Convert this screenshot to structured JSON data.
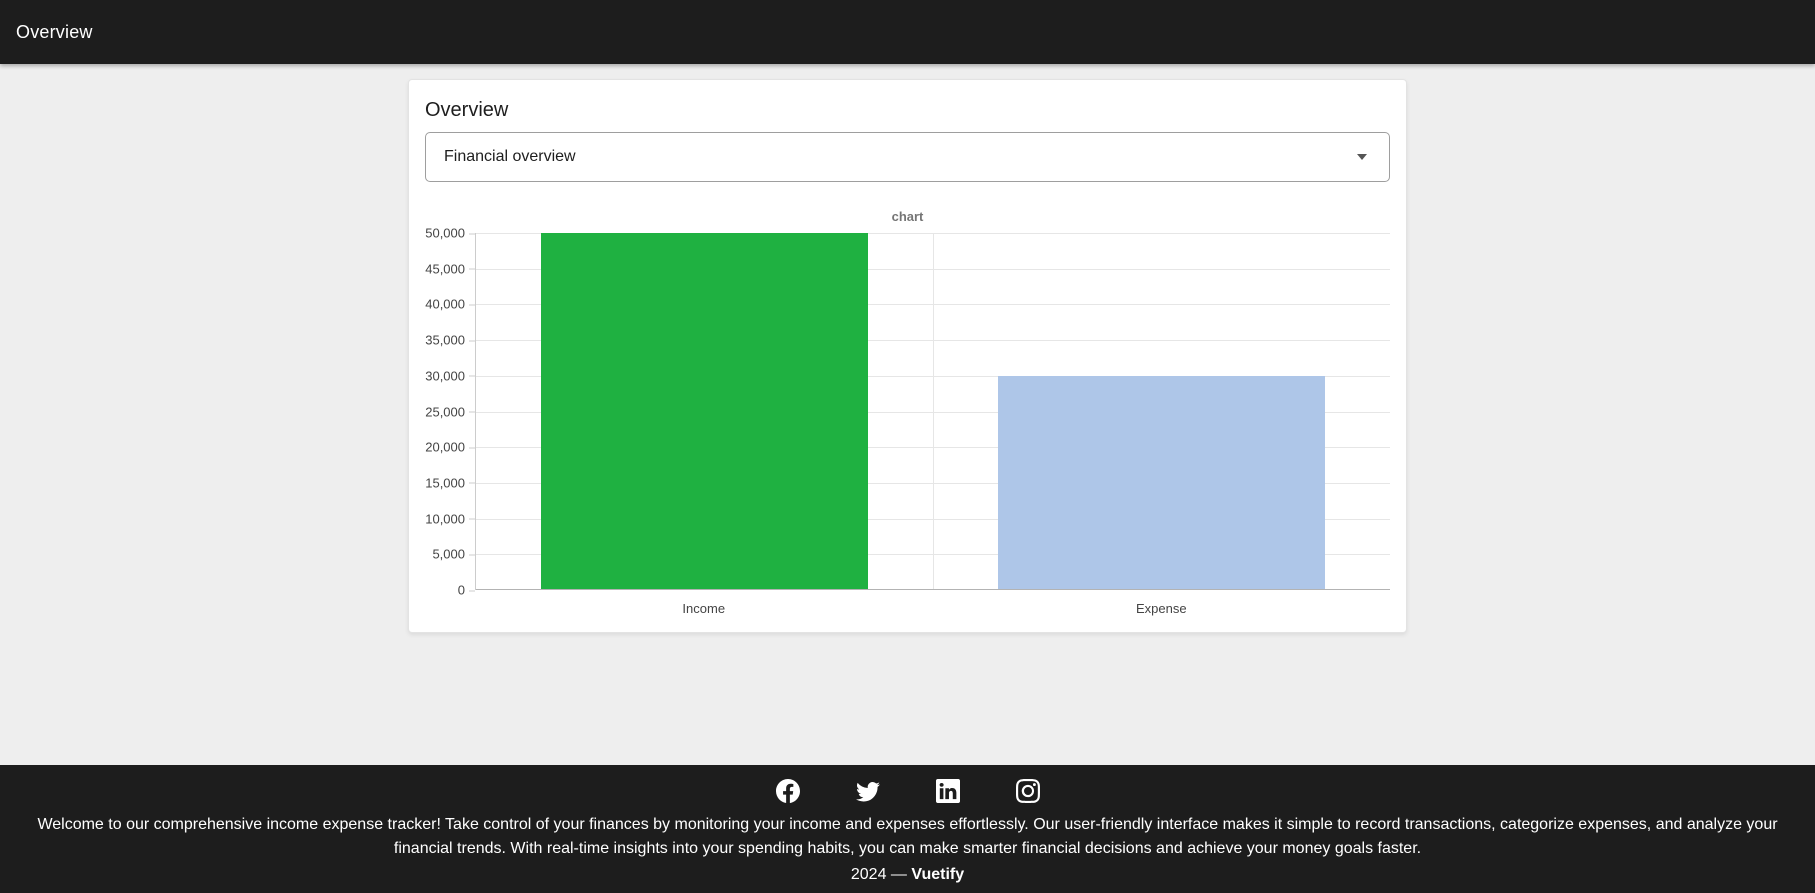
{
  "app_bar": {
    "title": "Overview"
  },
  "card": {
    "title": "Overview",
    "select": {
      "value": "Financial overview"
    }
  },
  "chart_data": {
    "type": "bar",
    "title": "chart",
    "categories": [
      "Income",
      "Expense"
    ],
    "values": [
      50000,
      30000
    ],
    "bar_colors": [
      "#1fb141",
      "#aec6e8"
    ],
    "ylim": [
      0,
      50000
    ],
    "ytick_step": 5000,
    "ytick_labels": [
      "0",
      "5,000",
      "10,000",
      "15,000",
      "20,000",
      "25,000",
      "30,000",
      "35,000",
      "40,000",
      "45,000",
      "50,000"
    ],
    "grid": true,
    "legend": "none",
    "xlabel": "",
    "ylabel": ""
  },
  "footer": {
    "icons": [
      {
        "name": "facebook"
      },
      {
        "name": "twitter"
      },
      {
        "name": "linkedin"
      },
      {
        "name": "instagram"
      }
    ],
    "description": "Welcome to our comprehensive income expense tracker! Take control of your finances by monitoring your income and expenses effortlessly. Our user-friendly interface makes it simple to record transactions, categorize expenses, and analyze your financial trends. With real-time insights into your spending habits, you can make smarter financial decisions and achieve your money goals faster.",
    "copyright_prefix": "2024 — ",
    "copyright_brand": "Vuetify"
  },
  "colors": {
    "app_bar_bg": "#1d1d1d",
    "page_bg": "#eeeeee",
    "footer_bg": "#1d1d1d",
    "bar_income": "#1fb141",
    "bar_expense": "#aec6e8",
    "gridline": "#e6e6e6",
    "axis_line": "#cccccc",
    "baseline": "#b3b3b3"
  }
}
